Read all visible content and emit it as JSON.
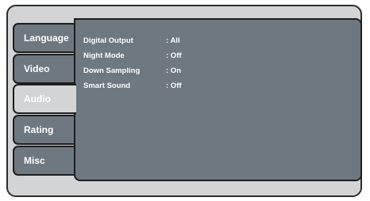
{
  "tabs": [
    {
      "label": "Language",
      "active": false
    },
    {
      "label": "Video",
      "active": false
    },
    {
      "label": "Audio",
      "active": true
    },
    {
      "label": "Rating",
      "active": false
    },
    {
      "label": "Misc",
      "active": false
    }
  ],
  "settings": [
    {
      "label": "Digital Output",
      "value": ": All"
    },
    {
      "label": "Night Mode",
      "value": ": Off"
    },
    {
      "label": "Down Sampling",
      "value": ": On"
    },
    {
      "label": "Smart Sound",
      "value": ": Off"
    }
  ],
  "colors": {
    "panel": "#6e7880",
    "frame": "#d2d4d6",
    "active_tab": "#d2d4d6",
    "text": "#ffffff"
  }
}
